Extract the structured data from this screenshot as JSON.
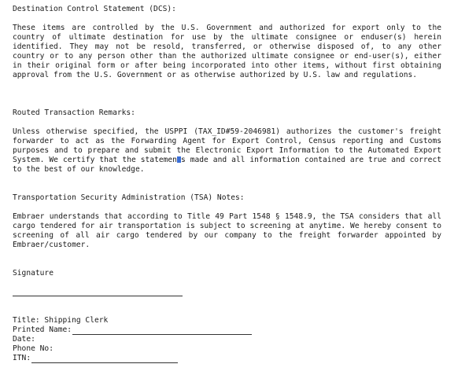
{
  "dcs": {
    "heading": "Destination Control Statement (DCS):",
    "body": "These items are controlled by the U.S. Government and authorized for export only to the country of ultimate destination for use by the ultimate consignee or enduser(s) herein identified. They may not be resold, transferred, or otherwise disposed of, to any other country or to any person other than the authorized ultimate consignee or end-user(s), either in their original form or after being incorporated into other items, without first obtaining approval from the U.S. Government or as otherwise authorized by U.S. law and regulations."
  },
  "routed": {
    "heading": "Routed Transaction Remarks:",
    "body_before_cursor": "Unless otherwise specified, the USPPI (TAX_ID#59-2046981) authorizes the customer's freight forwarder to act as the Forwarding Agent for Export Control, Census reporting and Customs purposes and to prepare and submit the Electronic Export Information to the Automated Export System. We certify that the statemen",
    "body_after_cursor": "s made and all information contained are true and correct to the best of our knowledge."
  },
  "tsa": {
    "heading": "Transportation Security Administration (TSA) Notes:",
    "body": "Embraer understands that according to Title 49 Part 1548 § 1548.9, the TSA considers that all cargo tendered for air transportation is subject to screening at anytime. We hereby consent to screening of all air cargo tendered by our company to the freight forwarder appointed by Embraer/customer."
  },
  "signature": {
    "label": "Signature"
  },
  "fields": {
    "title": "Title: Shipping Clerk",
    "printed_name": "Printed Name:",
    "date": "Date:",
    "phone": "Phone No:",
    "itn": "ITN:"
  }
}
